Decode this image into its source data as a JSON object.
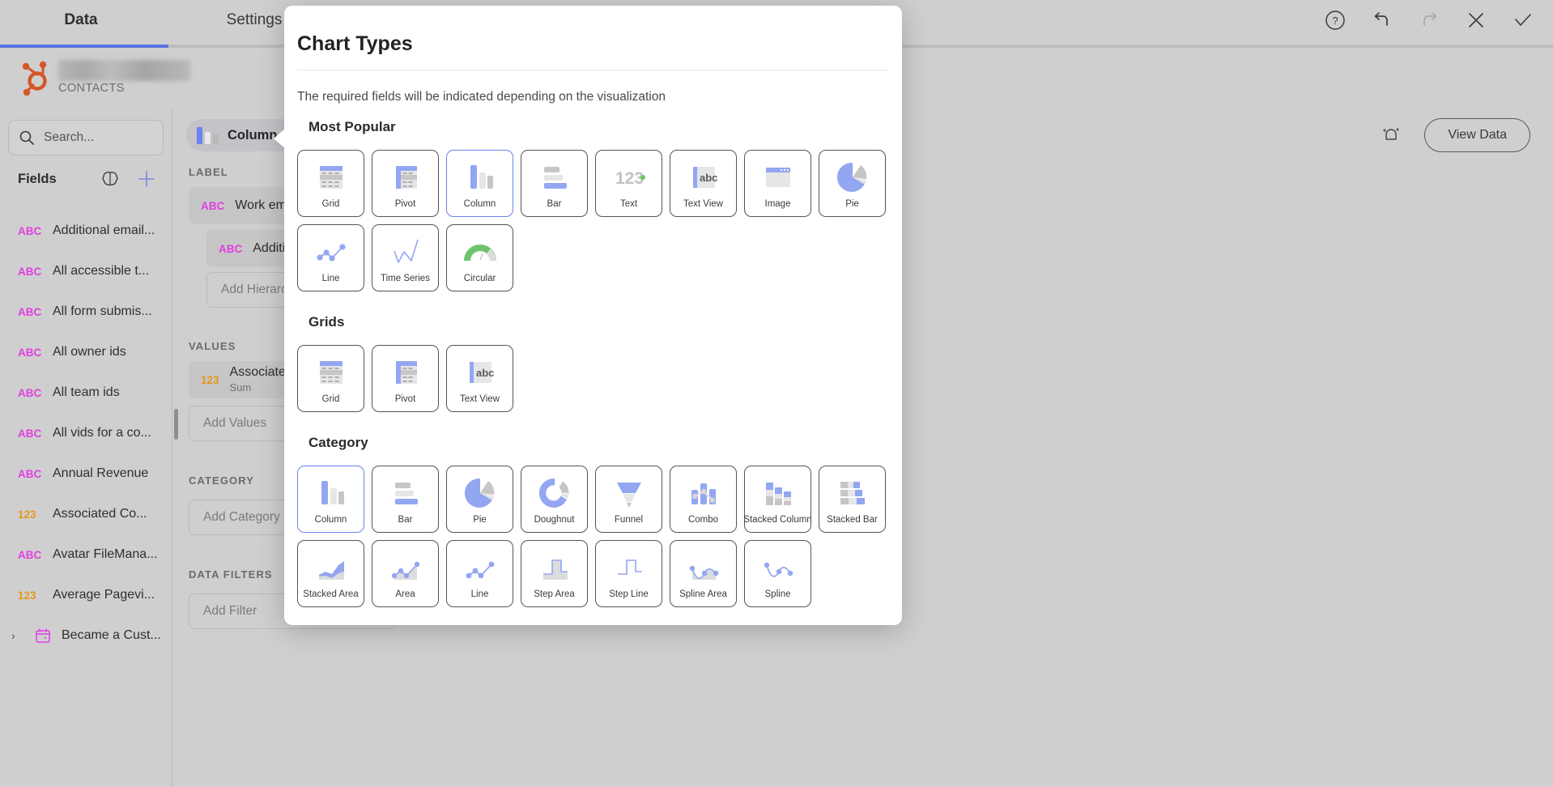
{
  "app": {
    "tabs": [
      {
        "id": "data",
        "label": "Data",
        "active": true
      },
      {
        "id": "settings",
        "label": "Settings",
        "active": false
      }
    ],
    "header_icons": [
      {
        "name": "help-icon",
        "label": "Help"
      },
      {
        "name": "undo-icon",
        "label": "Undo"
      },
      {
        "name": "redo-icon",
        "label": "Redo"
      },
      {
        "name": "close-icon",
        "label": "Close"
      },
      {
        "name": "confirm-icon",
        "label": "Apply"
      }
    ],
    "brand": {
      "name_redacted": true,
      "subtitle": "CONTACTS",
      "logo": "hubspot-logo"
    },
    "view_data_button": "View Data",
    "magic_icon": "ai-sparkle-icon"
  },
  "left_panel": {
    "search": {
      "placeholder": "Search...",
      "value": "",
      "icon": "search-icon"
    },
    "fields_header": "Fields",
    "brain_icon": "brain-icon",
    "add_icon": "plus-icon",
    "fields": [
      {
        "type": "ABC",
        "kind": "abc",
        "name": "Additional email..."
      },
      {
        "type": "ABC",
        "kind": "abc",
        "name": "All accessible t..."
      },
      {
        "type": "ABC",
        "kind": "abc",
        "name": "All form submis..."
      },
      {
        "type": "ABC",
        "kind": "abc",
        "name": "All owner ids"
      },
      {
        "type": "ABC",
        "kind": "abc",
        "name": "All team ids"
      },
      {
        "type": "ABC",
        "kind": "abc",
        "name": "All vids for a co..."
      },
      {
        "type": "ABC",
        "kind": "abc",
        "name": "Annual Revenue"
      },
      {
        "type": "123",
        "kind": "num",
        "name": "Associated Co..."
      },
      {
        "type": "ABC",
        "kind": "abc",
        "name": "Avatar FileMana..."
      },
      {
        "type": "123",
        "kind": "num",
        "name": "Average Pagevi..."
      },
      {
        "type": "DATE",
        "kind": "date",
        "name": "Became a Cust...",
        "expandable": true
      }
    ]
  },
  "mid_panel": {
    "chart_type_pill": {
      "label": "Column",
      "caret": "chevron-down-icon"
    },
    "sections": [
      {
        "title": "LABEL",
        "chips": [
          {
            "type": "ABC",
            "kind": "abc",
            "text": "Work email",
            "sub": ""
          },
          {
            "type": "ABC",
            "kind": "abc",
            "text": "Addition",
            "sub": "",
            "indent": true
          }
        ],
        "dropzone": "Add Hierarchy"
      },
      {
        "title": "VALUES",
        "chips": [
          {
            "type": "123",
            "kind": "num",
            "text": "Associated",
            "sub": "Sum"
          }
        ],
        "dropzone": "Add Values"
      },
      {
        "title": "CATEGORY",
        "chips": [],
        "dropzone": "Add Category"
      },
      {
        "title": "DATA FILTERS",
        "chips": [],
        "dropzone": "Add Filter"
      }
    ]
  },
  "modal": {
    "title": "Chart Types",
    "subtitle": "The required fields will be indicated depending on the visualization",
    "groups": [
      {
        "title": "Most Popular",
        "cards": [
          {
            "label": "Grid",
            "icon": "grid",
            "selected": false
          },
          {
            "label": "Pivot",
            "icon": "pivot",
            "selected": false
          },
          {
            "label": "Column",
            "icon": "column",
            "selected": true
          },
          {
            "label": "Bar",
            "icon": "bar",
            "selected": false
          },
          {
            "label": "Text",
            "icon": "text",
            "selected": false
          },
          {
            "label": "Text View",
            "icon": "textview",
            "selected": false
          },
          {
            "label": "Image",
            "icon": "image",
            "selected": false
          },
          {
            "label": "Pie",
            "icon": "pie",
            "selected": false
          },
          {
            "label": "Line",
            "icon": "line",
            "selected": false
          },
          {
            "label": "Time Series",
            "icon": "timeseries",
            "selected": false
          },
          {
            "label": "Circular",
            "icon": "circular",
            "selected": false
          }
        ]
      },
      {
        "title": "Grids",
        "cards": [
          {
            "label": "Grid",
            "icon": "grid",
            "selected": false
          },
          {
            "label": "Pivot",
            "icon": "pivot",
            "selected": false
          },
          {
            "label": "Text View",
            "icon": "textview",
            "selected": false
          }
        ]
      },
      {
        "title": "Category",
        "cards": [
          {
            "label": "Column",
            "icon": "column",
            "selected": true
          },
          {
            "label": "Bar",
            "icon": "bar",
            "selected": false
          },
          {
            "label": "Pie",
            "icon": "pie",
            "selected": false
          },
          {
            "label": "Doughnut",
            "icon": "doughnut",
            "selected": false
          },
          {
            "label": "Funnel",
            "icon": "funnel",
            "selected": false
          },
          {
            "label": "Combo",
            "icon": "combo",
            "selected": false
          },
          {
            "label": "Stacked Column",
            "icon": "stackedcolumn",
            "selected": false
          },
          {
            "label": "Stacked Bar",
            "icon": "stackedbar",
            "selected": false
          },
          {
            "label": "Stacked Area",
            "icon": "stackedarea",
            "selected": false
          },
          {
            "label": "Area",
            "icon": "area",
            "selected": false
          },
          {
            "label": "Line",
            "icon": "line2",
            "selected": false
          },
          {
            "label": "Step Area",
            "icon": "steparea",
            "selected": false
          },
          {
            "label": "Step Line",
            "icon": "stepline",
            "selected": false
          },
          {
            "label": "Spline Area",
            "icon": "splinearea",
            "selected": false
          },
          {
            "label": "Spline",
            "icon": "spline",
            "selected": false
          }
        ]
      }
    ]
  },
  "colors": {
    "accent": "#6b83ef",
    "accent_soft": "#93a6f2",
    "grey": "#c9c9c9",
    "grey_dark": "#b0b0b0",
    "abc": "#e040e0",
    "num": "#e8971a",
    "green": "#6cc46c",
    "hubspot": "#d4572a"
  }
}
